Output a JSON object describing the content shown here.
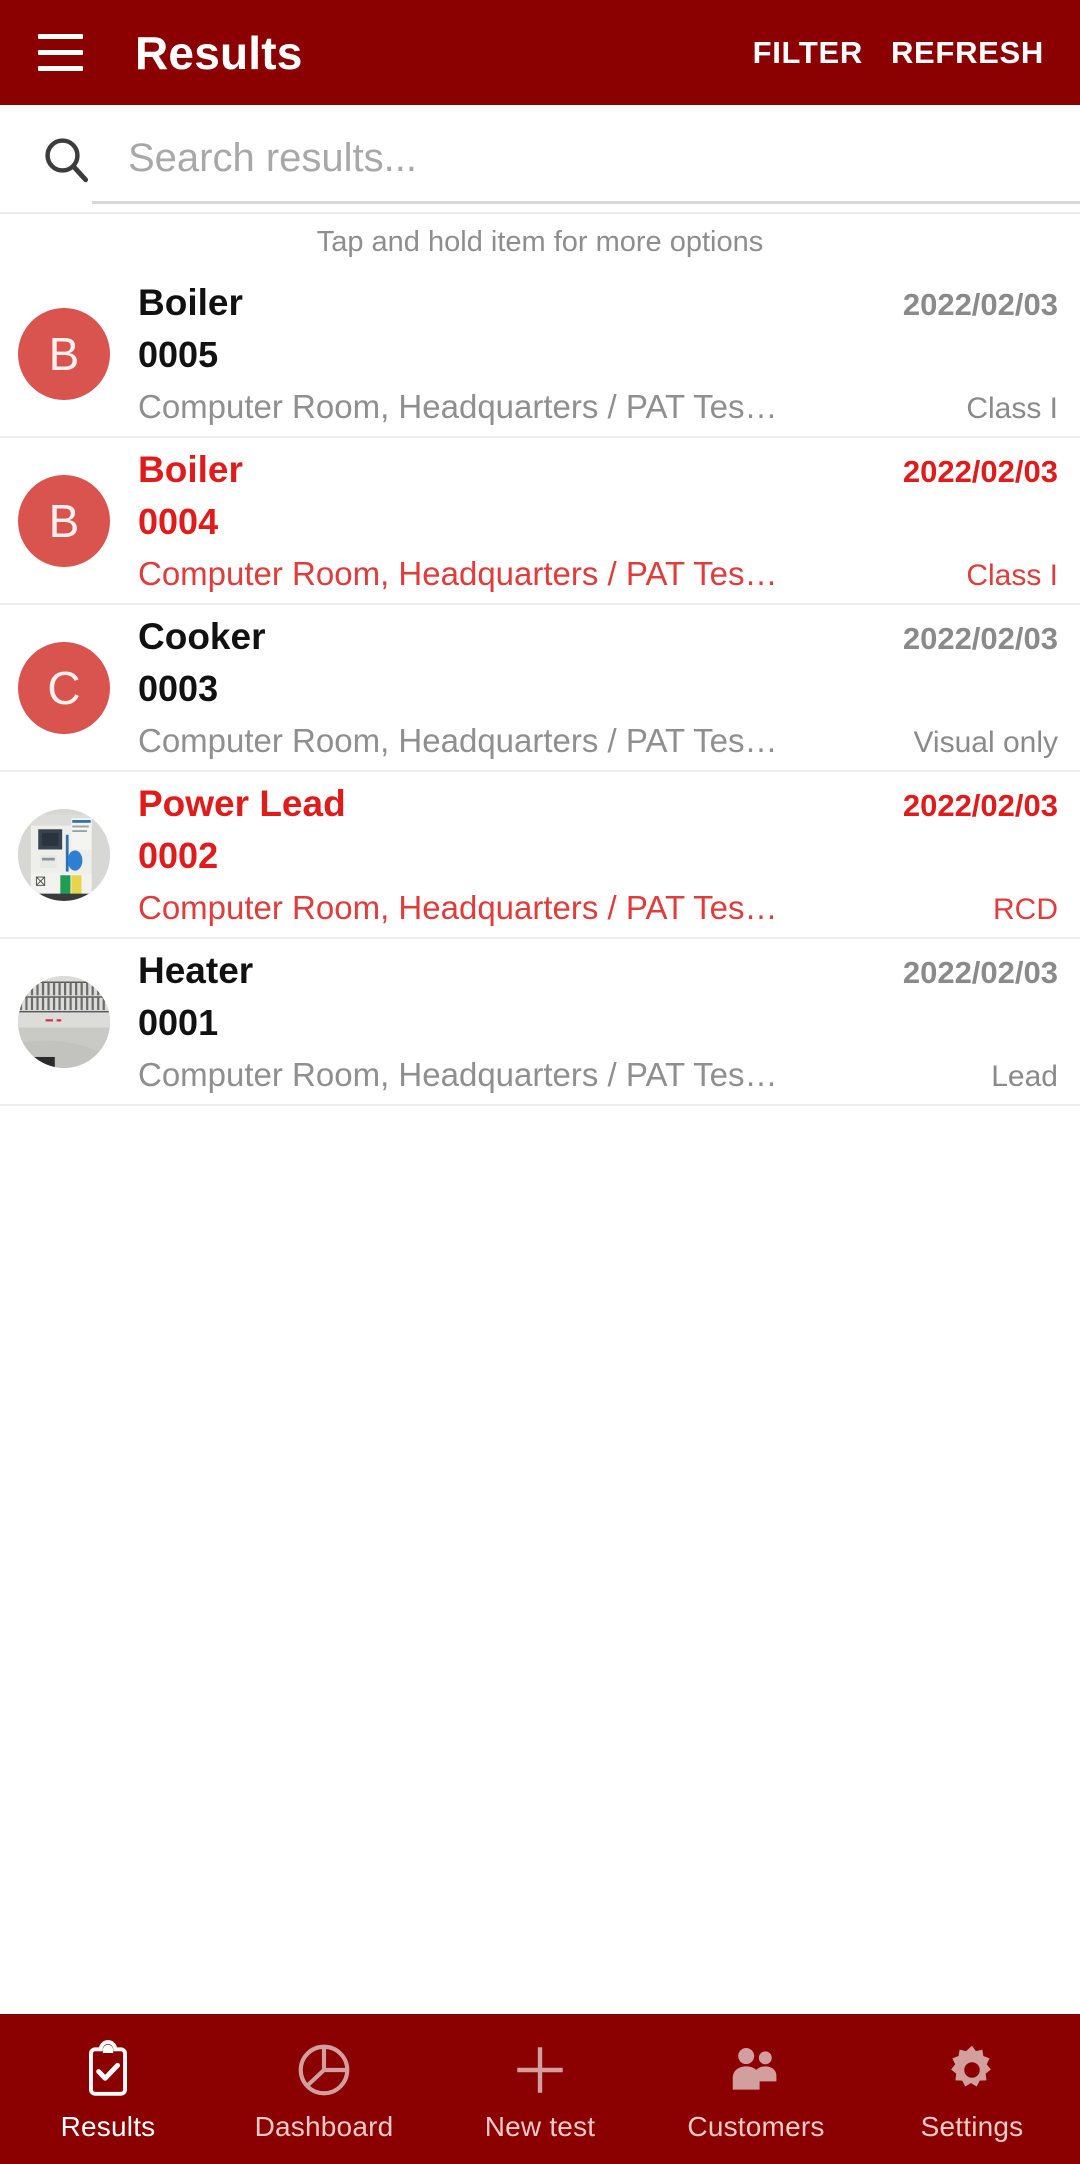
{
  "theme": {
    "primary": "#8b0000",
    "avatar_red": "#d9534f",
    "fail_red": "#e01b1b",
    "muted_gray": "#8a8a8a"
  },
  "appbar": {
    "menu_icon": "hamburger-menu-icon",
    "title": "Results",
    "actions": [
      {
        "label": "FILTER",
        "name": "filter-button"
      },
      {
        "label": "REFRESH",
        "name": "refresh-button"
      }
    ]
  },
  "search": {
    "icon": "search-icon",
    "placeholder": "Search results...",
    "value": ""
  },
  "hint": "Tap and hold item for more options",
  "list": {
    "items": [
      {
        "avatar_type": "letter",
        "avatar_letter": "B",
        "title": "Boiler",
        "number": "0005",
        "location": "Computer Room, Headquarters / PAT Tes…",
        "date": "2022/02/03",
        "badge": "Class I",
        "failed": false
      },
      {
        "avatar_type": "letter",
        "avatar_letter": "B",
        "title": "Boiler",
        "number": "0004",
        "location": "Computer Room, Headquarters / PAT Tes…",
        "date": "2022/02/03",
        "badge": "Class I",
        "failed": true
      },
      {
        "avatar_type": "letter",
        "avatar_letter": "C",
        "title": "Cooker",
        "number": "0003",
        "location": "Computer Room, Headquarters / PAT Tes…",
        "date": "2022/02/03",
        "badge": "Visual only",
        "failed": false
      },
      {
        "avatar_type": "photo",
        "avatar_photo": "rcd-breaker-photo",
        "title": "Power Lead",
        "number": "0002",
        "location": "Computer Room, Headquarters / PAT Tes…",
        "date": "2022/02/03",
        "badge": "RCD",
        "failed": true
      },
      {
        "avatar_type": "photo",
        "avatar_photo": "heater-grille-photo",
        "title": "Heater",
        "number": "0001",
        "location": "Computer Room, Headquarters / PAT Tes…",
        "date": "2022/02/03",
        "badge": "Lead",
        "failed": false
      }
    ]
  },
  "bottomnav": {
    "items": [
      {
        "label": "Results",
        "icon": "clipboard-check-icon",
        "active": true
      },
      {
        "label": "Dashboard",
        "icon": "pie-chart-icon",
        "active": false
      },
      {
        "label": "New test",
        "icon": "plus-icon",
        "active": false
      },
      {
        "label": "Customers",
        "icon": "people-group-icon",
        "active": false
      },
      {
        "label": "Settings",
        "icon": "gear-icon",
        "active": false
      }
    ]
  }
}
